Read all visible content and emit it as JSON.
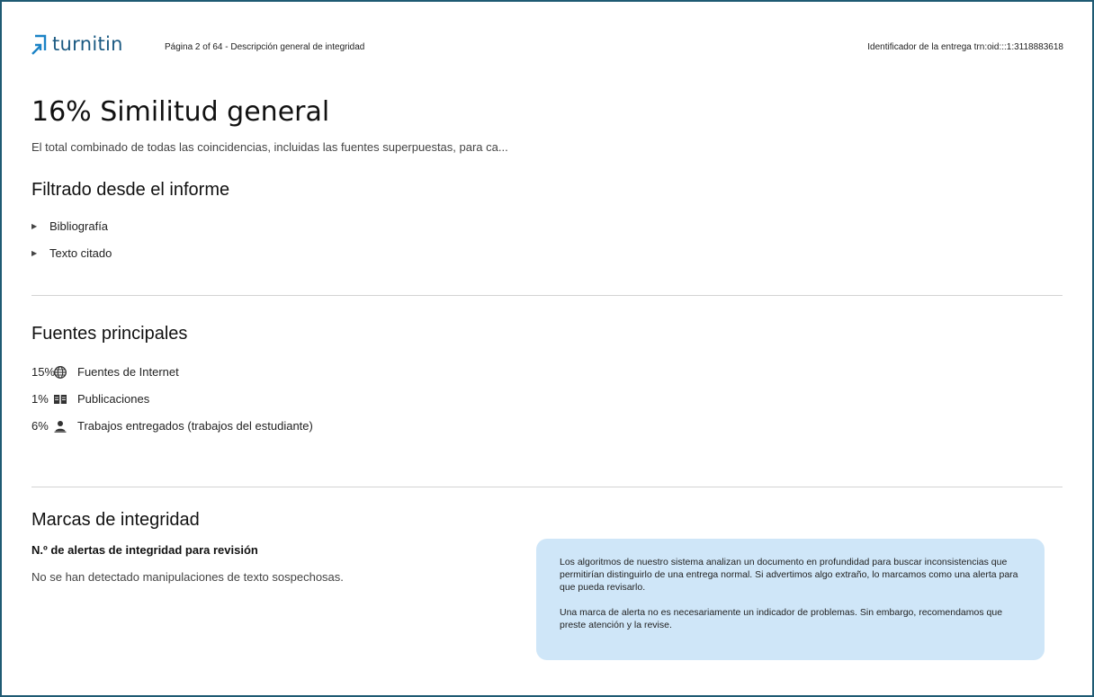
{
  "header": {
    "logo_text": "turnitin",
    "page_info": "Página 2 of 64 - Descripción general de integridad",
    "submission_id": "Identificador de la entrega trn:oid:::1:3118883618"
  },
  "summary": {
    "title": "16% Similitud general",
    "subtitle": "El total combinado de todas las coincidencias, incluidas las fuentes superpuestas, para ca..."
  },
  "filtered": {
    "heading": "Filtrado desde el informe",
    "items": [
      {
        "label": "Bibliografía"
      },
      {
        "label": "Texto citado"
      }
    ]
  },
  "sources": {
    "heading": "Fuentes principales",
    "items": [
      {
        "percent": "15%",
        "icon": "globe-icon",
        "label": "Fuentes de Internet"
      },
      {
        "percent": "1%",
        "icon": "book-icon",
        "label": "Publicaciones"
      },
      {
        "percent": "6%",
        "icon": "user-icon",
        "label": "Trabajos entregados (trabajos del estudiante)"
      }
    ]
  },
  "integrity": {
    "heading": "Marcas de integridad",
    "alerts_label": "N.º de alertas de integridad para revisión",
    "no_manipulation": "No se han detectado manipulaciones de texto sospechosas.",
    "info_p1": "Los algoritmos de nuestro sistema analizan un documento en profundidad para buscar inconsistencias que permitirían distinguirlo de una entrega normal. Si advertimos algo extraño, lo marcamos como una alerta para que pueda revisarlo.",
    "info_p2": "Una marca de alerta no es necesariamente un indicador de problemas. Sin embargo, recomendamos que preste atención y la revise."
  },
  "colors": {
    "frame_border": "#1f5a73",
    "brand": "#1b5a82",
    "info_box_bg": "#cfe6f8",
    "divider": "#d3d3d3"
  }
}
